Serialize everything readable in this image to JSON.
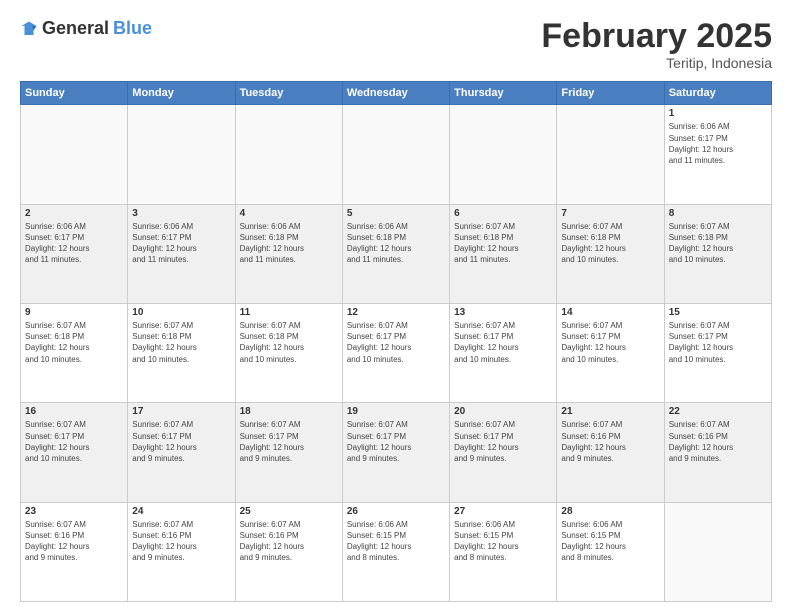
{
  "header": {
    "logo_general": "General",
    "logo_blue": "Blue",
    "month_year": "February 2025",
    "location": "Teritip, Indonesia"
  },
  "days_of_week": [
    "Sunday",
    "Monday",
    "Tuesday",
    "Wednesday",
    "Thursday",
    "Friday",
    "Saturday"
  ],
  "weeks": [
    {
      "shaded": false,
      "days": [
        {
          "num": "",
          "info": ""
        },
        {
          "num": "",
          "info": ""
        },
        {
          "num": "",
          "info": ""
        },
        {
          "num": "",
          "info": ""
        },
        {
          "num": "",
          "info": ""
        },
        {
          "num": "",
          "info": ""
        },
        {
          "num": "1",
          "info": "Sunrise: 6:06 AM\nSunset: 6:17 PM\nDaylight: 12 hours\nand 11 minutes."
        }
      ]
    },
    {
      "shaded": true,
      "days": [
        {
          "num": "2",
          "info": "Sunrise: 6:06 AM\nSunset: 6:17 PM\nDaylight: 12 hours\nand 11 minutes."
        },
        {
          "num": "3",
          "info": "Sunrise: 6:06 AM\nSunset: 6:17 PM\nDaylight: 12 hours\nand 11 minutes."
        },
        {
          "num": "4",
          "info": "Sunrise: 6:06 AM\nSunset: 6:18 PM\nDaylight: 12 hours\nand 11 minutes."
        },
        {
          "num": "5",
          "info": "Sunrise: 6:06 AM\nSunset: 6:18 PM\nDaylight: 12 hours\nand 11 minutes."
        },
        {
          "num": "6",
          "info": "Sunrise: 6:07 AM\nSunset: 6:18 PM\nDaylight: 12 hours\nand 11 minutes."
        },
        {
          "num": "7",
          "info": "Sunrise: 6:07 AM\nSunset: 6:18 PM\nDaylight: 12 hours\nand 10 minutes."
        },
        {
          "num": "8",
          "info": "Sunrise: 6:07 AM\nSunset: 6:18 PM\nDaylight: 12 hours\nand 10 minutes."
        }
      ]
    },
    {
      "shaded": false,
      "days": [
        {
          "num": "9",
          "info": "Sunrise: 6:07 AM\nSunset: 6:18 PM\nDaylight: 12 hours\nand 10 minutes."
        },
        {
          "num": "10",
          "info": "Sunrise: 6:07 AM\nSunset: 6:18 PM\nDaylight: 12 hours\nand 10 minutes."
        },
        {
          "num": "11",
          "info": "Sunrise: 6:07 AM\nSunset: 6:18 PM\nDaylight: 12 hours\nand 10 minutes."
        },
        {
          "num": "12",
          "info": "Sunrise: 6:07 AM\nSunset: 6:17 PM\nDaylight: 12 hours\nand 10 minutes."
        },
        {
          "num": "13",
          "info": "Sunrise: 6:07 AM\nSunset: 6:17 PM\nDaylight: 12 hours\nand 10 minutes."
        },
        {
          "num": "14",
          "info": "Sunrise: 6:07 AM\nSunset: 6:17 PM\nDaylight: 12 hours\nand 10 minutes."
        },
        {
          "num": "15",
          "info": "Sunrise: 6:07 AM\nSunset: 6:17 PM\nDaylight: 12 hours\nand 10 minutes."
        }
      ]
    },
    {
      "shaded": true,
      "days": [
        {
          "num": "16",
          "info": "Sunrise: 6:07 AM\nSunset: 6:17 PM\nDaylight: 12 hours\nand 10 minutes."
        },
        {
          "num": "17",
          "info": "Sunrise: 6:07 AM\nSunset: 6:17 PM\nDaylight: 12 hours\nand 9 minutes."
        },
        {
          "num": "18",
          "info": "Sunrise: 6:07 AM\nSunset: 6:17 PM\nDaylight: 12 hours\nand 9 minutes."
        },
        {
          "num": "19",
          "info": "Sunrise: 6:07 AM\nSunset: 6:17 PM\nDaylight: 12 hours\nand 9 minutes."
        },
        {
          "num": "20",
          "info": "Sunrise: 6:07 AM\nSunset: 6:17 PM\nDaylight: 12 hours\nand 9 minutes."
        },
        {
          "num": "21",
          "info": "Sunrise: 6:07 AM\nSunset: 6:16 PM\nDaylight: 12 hours\nand 9 minutes."
        },
        {
          "num": "22",
          "info": "Sunrise: 6:07 AM\nSunset: 6:16 PM\nDaylight: 12 hours\nand 9 minutes."
        }
      ]
    },
    {
      "shaded": false,
      "days": [
        {
          "num": "23",
          "info": "Sunrise: 6:07 AM\nSunset: 6:16 PM\nDaylight: 12 hours\nand 9 minutes."
        },
        {
          "num": "24",
          "info": "Sunrise: 6:07 AM\nSunset: 6:16 PM\nDaylight: 12 hours\nand 9 minutes."
        },
        {
          "num": "25",
          "info": "Sunrise: 6:07 AM\nSunset: 6:16 PM\nDaylight: 12 hours\nand 9 minutes."
        },
        {
          "num": "26",
          "info": "Sunrise: 6:06 AM\nSunset: 6:15 PM\nDaylight: 12 hours\nand 8 minutes."
        },
        {
          "num": "27",
          "info": "Sunrise: 6:06 AM\nSunset: 6:15 PM\nDaylight: 12 hours\nand 8 minutes."
        },
        {
          "num": "28",
          "info": "Sunrise: 6:06 AM\nSunset: 6:15 PM\nDaylight: 12 hours\nand 8 minutes."
        },
        {
          "num": "",
          "info": ""
        }
      ]
    }
  ]
}
